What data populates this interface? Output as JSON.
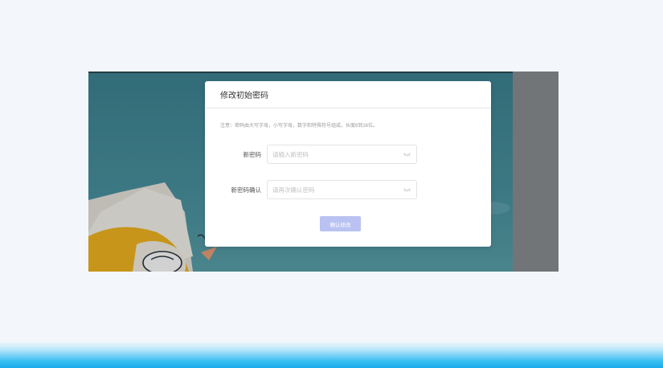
{
  "dialog": {
    "title": "修改初始密码",
    "notice": "注意：密码由大写字母，小写字母，数字和特殊符号组成，长度8到16位。",
    "fields": [
      {
        "label": "新密码",
        "placeholder": "请输入新密码",
        "value": ""
      },
      {
        "label": "新密码确认",
        "placeholder": "请再次确认密码",
        "value": ""
      }
    ],
    "submit_label": "确认修改"
  },
  "icons": {
    "password_toggle": "eye-closed-icon"
  },
  "colors": {
    "primary_button": "#b9c2f2",
    "bottom_gradient": "#1aa9ec",
    "background": "#f3f7fb"
  }
}
